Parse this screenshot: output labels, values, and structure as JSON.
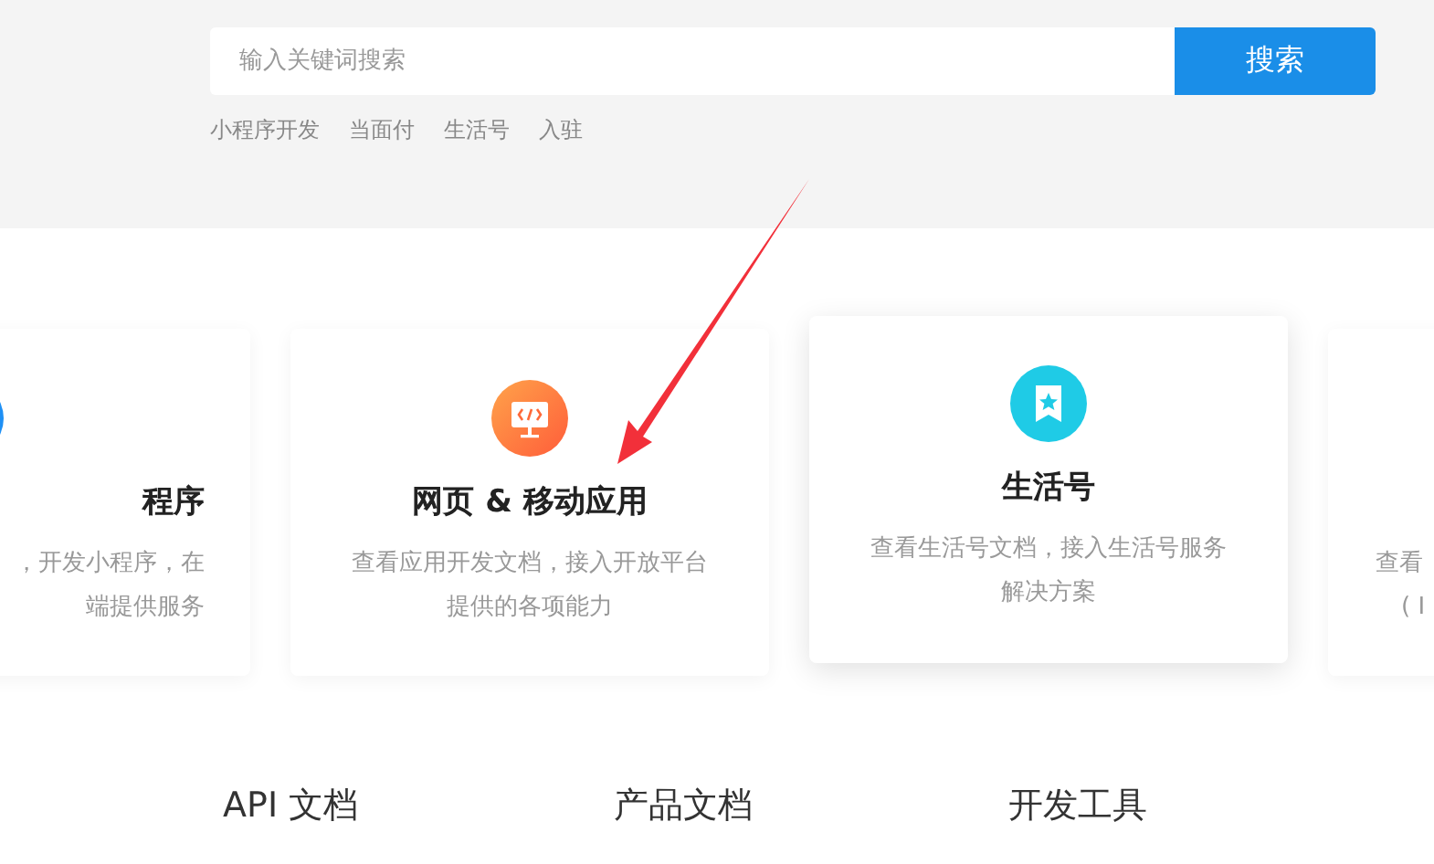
{
  "search": {
    "placeholder": "输入关键词搜索",
    "button": "搜索"
  },
  "hot_links": [
    "小程序开发",
    "当面付",
    "生活号",
    "入驻"
  ],
  "cards": [
    {
      "title": "程序",
      "description": [
        "，开发小程序，在",
        "端提供服务"
      ],
      "highlighted": false
    },
    {
      "title": "网页 & 移动应用",
      "description": [
        "查看应用开发文档，接入开放平台",
        "提供的各项能力"
      ],
      "highlighted": false
    },
    {
      "title": "生活号",
      "description": [
        "查看生活号文档，接入生活号服务",
        "解决方案"
      ],
      "highlighted": true
    },
    {
      "description": [
        "查看",
        "( I"
      ],
      "highlighted": false
    }
  ],
  "bottom_links": [
    "API 文档",
    "产品文档",
    "开发工具"
  ]
}
